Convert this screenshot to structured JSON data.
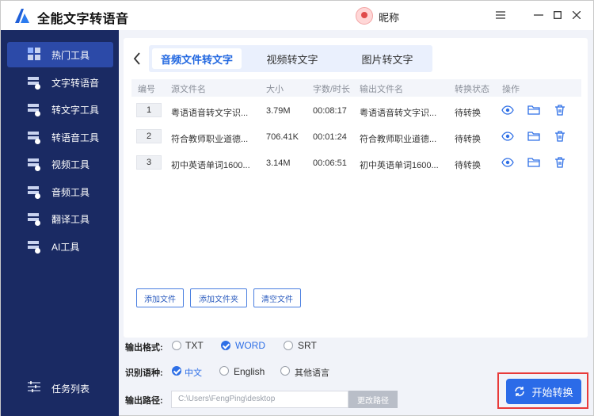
{
  "app": {
    "title": "全能文字转语音",
    "nickname": "昵称",
    "accent": "#2b6be8",
    "sidebar_bg": "#1a2a63"
  },
  "sidebar": {
    "items": [
      {
        "label": "热门工具",
        "icon": "grid-icon",
        "active": true
      },
      {
        "label": "文字转语音",
        "icon": "stack-icon"
      },
      {
        "label": "转文字工具",
        "icon": "stack-icon"
      },
      {
        "label": "转语音工具",
        "icon": "stack-icon"
      },
      {
        "label": "视频工具",
        "icon": "stack-icon"
      },
      {
        "label": "音频工具",
        "icon": "stack-icon"
      },
      {
        "label": "翻译工具",
        "icon": "stack-icon"
      },
      {
        "label": "AI工具",
        "icon": "stack-icon"
      }
    ],
    "task_list": "任务列表"
  },
  "tabs": [
    {
      "label": "音频文件转文字",
      "active": true
    },
    {
      "label": "视频转文字"
    },
    {
      "label": "图片转文字"
    }
  ],
  "table": {
    "headers": [
      "编号",
      "源文件名",
      "大小",
      "字数/时长",
      "输出文件名",
      "转换状态",
      "操作"
    ],
    "rows": [
      {
        "no": "1",
        "source": "粤语语音转文字识...",
        "size": "3.79M",
        "duration": "00:08:17",
        "output": "粤语语音转文字识...",
        "status": "待转换"
      },
      {
        "no": "2",
        "source": "符合教师职业道德...",
        "size": "706.41K",
        "duration": "00:01:24",
        "output": "符合教师职业道德...",
        "status": "待转换"
      },
      {
        "no": "3",
        "source": "初中英语单词1600...",
        "size": "3.14M",
        "duration": "00:06:51",
        "output": "初中英语单词1600...",
        "status": "待转换"
      }
    ]
  },
  "buttons": {
    "add_file": "添加文件",
    "add_folder": "添加文件夹",
    "clear": "清空文件",
    "change_path": "更改路径",
    "start": "开始转换"
  },
  "output_format": {
    "label": "输出格式:",
    "options": [
      "TXT",
      "WORD",
      "SRT"
    ],
    "selected": "WORD"
  },
  "language": {
    "label": "识别语种:",
    "options": [
      "中文",
      "English",
      "其他语言"
    ],
    "selected": "中文"
  },
  "output_path": {
    "label": "输出路径:",
    "value": "C:\\Users\\FengPing\\desktop"
  }
}
